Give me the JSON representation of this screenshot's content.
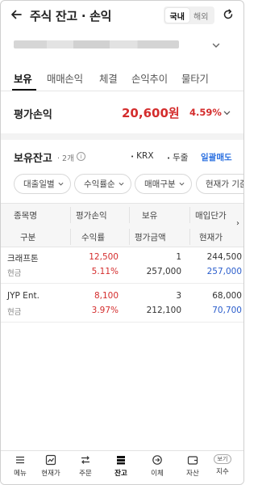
{
  "header": {
    "title": "주식 잔고 · 손익",
    "segment": [
      "국내",
      "해외"
    ]
  },
  "tabs": [
    "보유",
    "매매손익",
    "체결",
    "손익추이",
    "물타기"
  ],
  "pl": {
    "label": "평가손익",
    "amount": "20,600원",
    "percent": "4.59%"
  },
  "holdings": {
    "title": "보유잔고",
    "count": "· 2개",
    "markets": [
      "KRX",
      "두줄"
    ],
    "sell_all": "일괄매도"
  },
  "filters": [
    "대출일별",
    "수익률순",
    "매매구분",
    "현재가 기준"
  ],
  "table": {
    "header_row1": [
      "종목명",
      "평가손익",
      "보유",
      "매입단가"
    ],
    "header_row2": [
      "구분",
      "수익률",
      "평가금액",
      "현재가"
    ],
    "rows": [
      {
        "name": "크래프톤",
        "type": "현금",
        "pl": "12,500",
        "rate": "5.11%",
        "qty": "1",
        "eval": "257,000",
        "buy_price": "244,500",
        "cur_price": "257,000"
      },
      {
        "name": "JYP Ent.",
        "type": "현금",
        "pl": "8,100",
        "rate": "3.97%",
        "qty": "3",
        "eval": "212,100",
        "buy_price": "68,000",
        "cur_price": "70,700"
      }
    ]
  },
  "nav": [
    "메뉴",
    "현재가",
    "주문",
    "잔고",
    "이체",
    "자산",
    "지수"
  ],
  "nav_badge": "보기",
  "colors": {
    "red": "#d42d2d",
    "blue": "#2a5dcc",
    "link": "#2a6fe0"
  }
}
